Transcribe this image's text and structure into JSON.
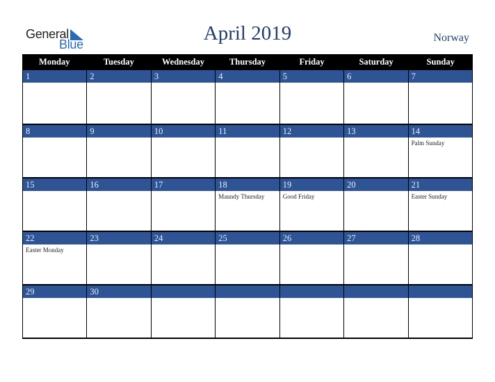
{
  "logo": {
    "word1": "General",
    "word2": "Blue"
  },
  "title": "April 2019",
  "country": "Norway",
  "weekdays": [
    "Monday",
    "Tuesday",
    "Wednesday",
    "Thursday",
    "Friday",
    "Saturday",
    "Sunday"
  ],
  "weeks": [
    [
      {
        "day": "1",
        "holiday": ""
      },
      {
        "day": "2",
        "holiday": ""
      },
      {
        "day": "3",
        "holiday": ""
      },
      {
        "day": "4",
        "holiday": ""
      },
      {
        "day": "5",
        "holiday": ""
      },
      {
        "day": "6",
        "holiday": ""
      },
      {
        "day": "7",
        "holiday": ""
      }
    ],
    [
      {
        "day": "8",
        "holiday": ""
      },
      {
        "day": "9",
        "holiday": ""
      },
      {
        "day": "10",
        "holiday": ""
      },
      {
        "day": "11",
        "holiday": ""
      },
      {
        "day": "12",
        "holiday": ""
      },
      {
        "day": "13",
        "holiday": ""
      },
      {
        "day": "14",
        "holiday": "Palm Sunday"
      }
    ],
    [
      {
        "day": "15",
        "holiday": ""
      },
      {
        "day": "16",
        "holiday": ""
      },
      {
        "day": "17",
        "holiday": ""
      },
      {
        "day": "18",
        "holiday": "Maundy Thursday"
      },
      {
        "day": "19",
        "holiday": "Good Friday"
      },
      {
        "day": "20",
        "holiday": ""
      },
      {
        "day": "21",
        "holiday": "Easter Sunday"
      }
    ],
    [
      {
        "day": "22",
        "holiday": "Easter Monday"
      },
      {
        "day": "23",
        "holiday": ""
      },
      {
        "day": "24",
        "holiday": ""
      },
      {
        "day": "25",
        "holiday": ""
      },
      {
        "day": "26",
        "holiday": ""
      },
      {
        "day": "27",
        "holiday": ""
      },
      {
        "day": "28",
        "holiday": ""
      }
    ],
    [
      {
        "day": "29",
        "holiday": ""
      },
      {
        "day": "30",
        "holiday": ""
      },
      {
        "day": "",
        "holiday": ""
      },
      {
        "day": "",
        "holiday": ""
      },
      {
        "day": "",
        "holiday": ""
      },
      {
        "day": "",
        "holiday": ""
      },
      {
        "day": "",
        "holiday": ""
      }
    ]
  ],
  "colors": {
    "header_bg": "#000000",
    "date_band": "#2e5496",
    "title": "#233d6a",
    "logo_blue": "#2a6ab5"
  }
}
